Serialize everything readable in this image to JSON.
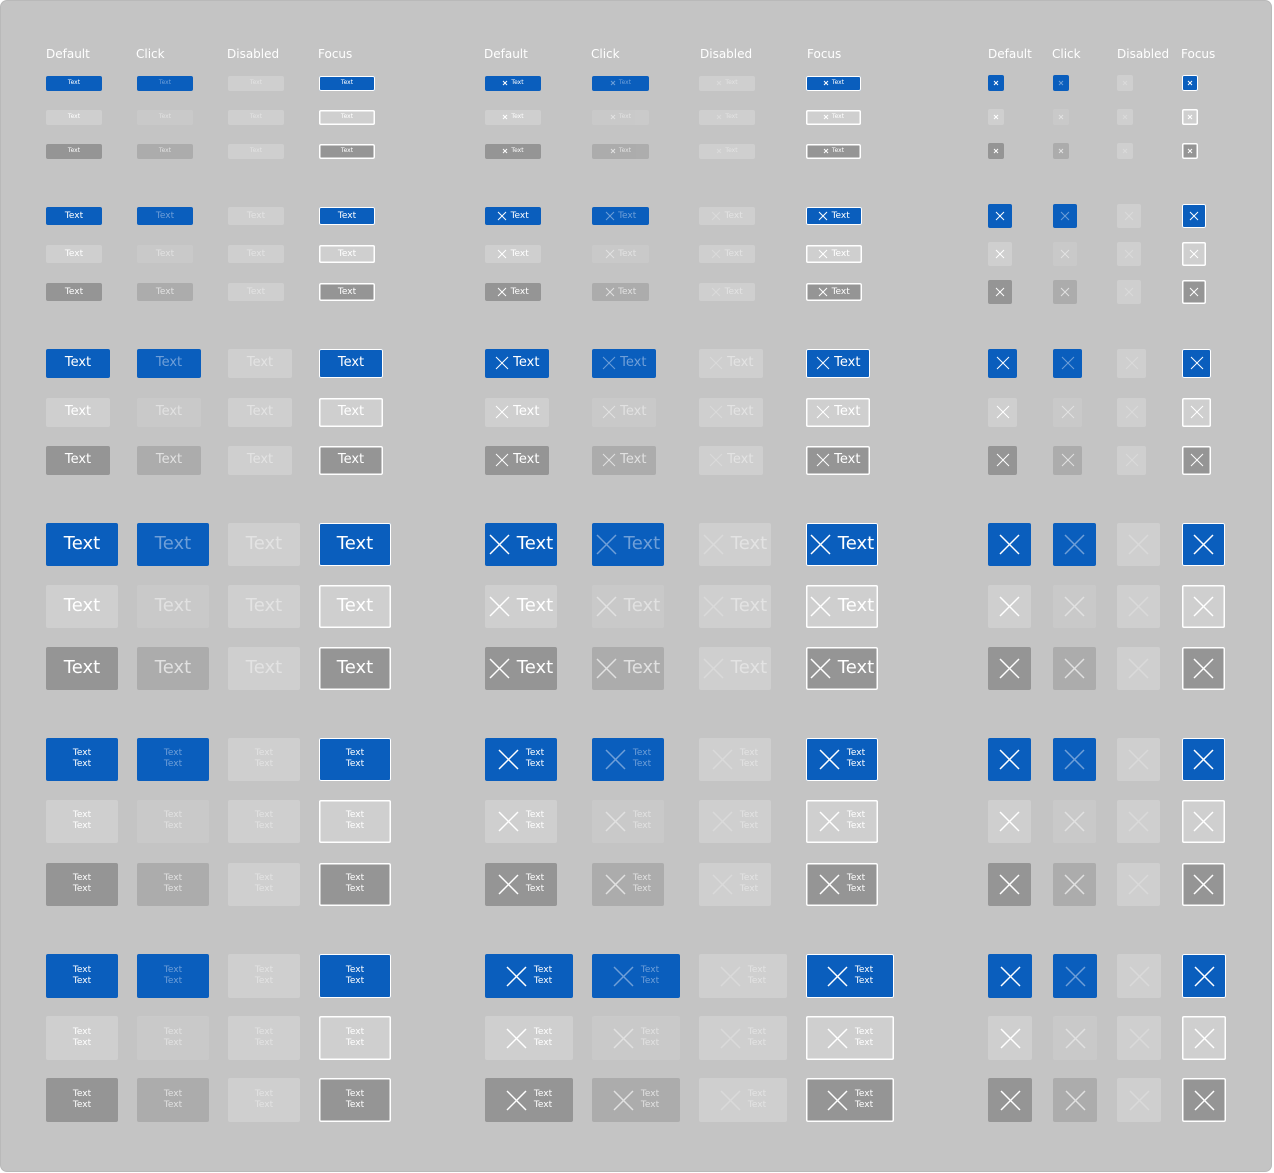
{
  "headers": {
    "text_buttons": [
      "Default",
      "Click",
      "Disabled",
      "Focus"
    ],
    "icon_text_buttons": [
      "Default",
      "Click",
      "Disabled",
      "Focus"
    ],
    "icon_buttons": [
      "Default",
      "Click",
      "Disabled",
      "Focus"
    ]
  },
  "button_label": "Text",
  "two_line_label": [
    "Text",
    "Text"
  ],
  "icon": "close-icon",
  "states": [
    "default",
    "click",
    "disabled",
    "focus"
  ],
  "variants": [
    "primary",
    "secondary",
    "tertiary"
  ],
  "size_groups": [
    "xs",
    "s",
    "m",
    "l",
    "xl-two-line",
    "xl-two-line-wide"
  ],
  "colors": {
    "background": "#c4c4c4",
    "primary": "#0a5ebd",
    "secondary": "#cfcfcf",
    "tertiary": "#959595",
    "text": "#ffffff"
  }
}
